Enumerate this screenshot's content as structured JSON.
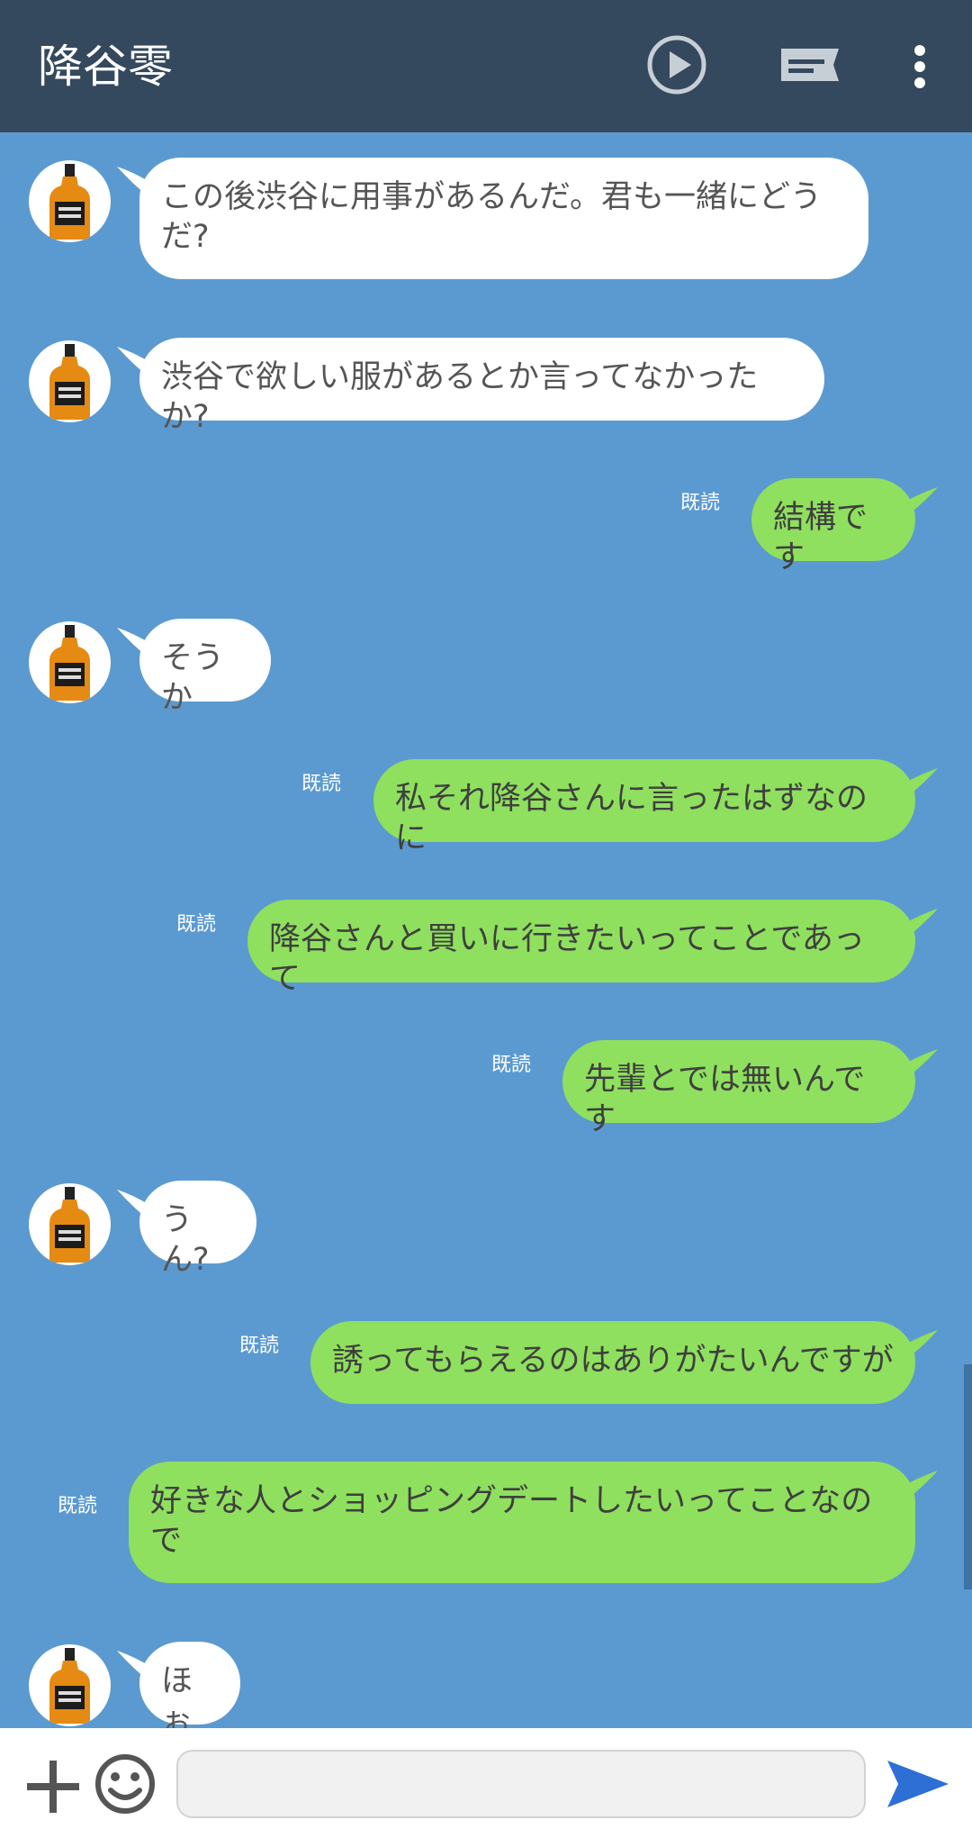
{
  "header": {
    "title": "降谷零",
    "icons": [
      "play-circle-icon",
      "keyboard-icon",
      "more-vert-icon"
    ]
  },
  "messages": [
    {
      "side": "in",
      "lines": [
        "この後渋谷に用事があるんだ。君も一緒にどう",
        "だ?"
      ]
    },
    {
      "side": "in",
      "lines": [
        "渋谷で欲しい服があるとか言ってなかったか?"
      ]
    },
    {
      "side": "out",
      "read": "既読",
      "lines": [
        "結構です"
      ]
    },
    {
      "side": "in",
      "lines": [
        "そうか"
      ]
    },
    {
      "side": "out",
      "read": "既読",
      "lines": [
        "私それ降谷さんに言ったはずなのに"
      ]
    },
    {
      "side": "out",
      "read": "既読",
      "lines": [
        "降谷さんと買いに行きたいってことであって"
      ]
    },
    {
      "side": "out",
      "read": "既読",
      "lines": [
        "先輩とでは無いんです"
      ]
    },
    {
      "side": "in",
      "lines": [
        "うん?"
      ]
    },
    {
      "side": "out",
      "read": "既読",
      "lines": [
        "誘ってもらえるのはありがたいんですが"
      ]
    },
    {
      "side": "out",
      "read": "既読",
      "lines": [
        "好きな人とショッピングデートしたいってことなの",
        "で"
      ]
    },
    {
      "side": "in",
      "lines": [
        "ほぉ"
      ]
    }
  ],
  "footer": {
    "input_value": "",
    "icons": [
      "plus-icon",
      "emoji-icon",
      "send-icon"
    ]
  },
  "colors": {
    "header_bg": "#34495e",
    "chat_bg": "#5b9ad0",
    "incoming_bubble": "#ffffff",
    "outgoing_bubble": "#8fe05e",
    "send_icon": "#2e6fd6"
  }
}
